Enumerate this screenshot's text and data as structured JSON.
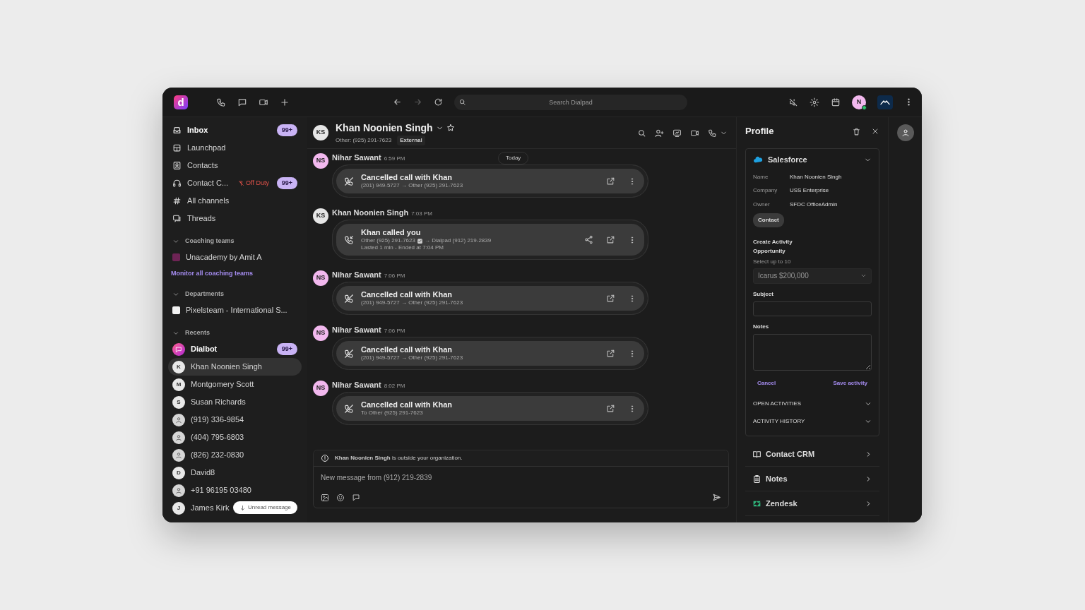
{
  "app_bar": {
    "logo": "d",
    "search_placeholder": "Search Dialpad",
    "user": {
      "initial": "N",
      "online": true
    }
  },
  "sidebar": {
    "nav": [
      {
        "label": "Inbox",
        "badge": "99+",
        "unread": true
      },
      {
        "label": "Launchpad",
        "unread": false
      },
      {
        "label": "Contacts",
        "unread": false
      },
      {
        "label": "Contact C...",
        "status": "Off Duty",
        "badge": "99+",
        "unread": false
      },
      {
        "label": "All channels",
        "unread": false
      },
      {
        "label": "Threads",
        "unread": false
      }
    ],
    "coaching_teams": {
      "title": "Coaching teams",
      "expanded": true,
      "items": [
        {
          "label": "Unacademy by Amit A",
          "color": "#6e2455"
        }
      ],
      "link": "Monitor all coaching teams"
    },
    "departments": {
      "title": "Departments",
      "expanded": true,
      "items": [
        {
          "label": "Pixelsteam - International S...",
          "color": "#f2f2f2"
        }
      ]
    },
    "recents": {
      "title": "Recents",
      "expanded": true,
      "items": [
        {
          "label": "Dialbot",
          "kind": "bot",
          "badge": "99+",
          "unread": true,
          "selected": false
        },
        {
          "label": "Khan Noonien Singh",
          "kind": "initial",
          "initial": "K",
          "unread": false,
          "selected": true
        },
        {
          "label": "Montgomery Scott",
          "kind": "initial",
          "initial": "M",
          "unread": false,
          "selected": false
        },
        {
          "label": "Susan Richards",
          "kind": "initial",
          "initial": "S",
          "unread": false,
          "selected": false
        },
        {
          "label": "(919) 336-9854",
          "kind": "person",
          "unread": false,
          "selected": false
        },
        {
          "label": "(404) 795-6803",
          "kind": "person",
          "unread": false,
          "selected": false
        },
        {
          "label": "(826) 232-0830",
          "kind": "person",
          "unread": false,
          "selected": false
        },
        {
          "label": "David8",
          "kind": "initial",
          "initial": "D",
          "unread": false,
          "selected": false
        },
        {
          "label": "+91 96195 03480",
          "kind": "person",
          "unread": false,
          "selected": false
        },
        {
          "label": "James Kirk",
          "kind": "initial",
          "initial": "J",
          "unread": false,
          "selected": false
        }
      ]
    },
    "unread_pill": "Unread message"
  },
  "conversation": {
    "avatar": "KS",
    "name": "Khan Noonien Singh",
    "starred": false,
    "phone": "Other: (925) 291-7623",
    "tag": "External",
    "date_divider": "Today",
    "messages": [
      {
        "avatar": "NS",
        "color": "#f2b8ee",
        "sender": "Nihar Sawant",
        "time": "6:59 PM",
        "call": {
          "kind": "cancelled",
          "title": "Cancelled call with Khan",
          "route": "(201) 949-5727 → Other (925) 291-7623",
          "share": false
        }
      },
      {
        "avatar": "KS",
        "color": "#e6e6e6",
        "sender": "Khan Noonien Singh",
        "time": "7:03 PM",
        "call": {
          "kind": "incoming",
          "title": "Khan called you",
          "route": "Other (925) 291-7623",
          "verified": true,
          "route_to": "→ Dialpad (912) 219-2839",
          "detail": "Lasted 1 min - Ended at 7:04 PM",
          "share": true
        }
      },
      {
        "avatar": "NS",
        "color": "#f2b8ee",
        "sender": "Nihar Sawant",
        "time": "7:06 PM",
        "call": {
          "kind": "cancelled",
          "title": "Cancelled call with Khan",
          "route": "(201) 949-5727 → Other (925) 291-7623",
          "share": false
        }
      },
      {
        "avatar": "NS",
        "color": "#f2b8ee",
        "sender": "Nihar Sawant",
        "time": "7:06 PM",
        "call": {
          "kind": "cancelled",
          "title": "Cancelled call with Khan",
          "route": "(201) 949-5727 → Other (925) 291-7623",
          "share": false
        }
      },
      {
        "avatar": "NS",
        "color": "#f2b8ee",
        "sender": "Nihar Sawant",
        "time": "8:02 PM",
        "call": {
          "kind": "cancelled",
          "title": "Cancelled call with Khan",
          "route": "To Other (925) 291-7623",
          "share": false
        }
      }
    ],
    "notice": "**Khan Noonien Singh** is outside your organization.",
    "composer": {
      "placeholder": "New message from (912) 219-2839"
    }
  },
  "profile": {
    "title": "Profile",
    "salesforce": {
      "title": "Salesforce",
      "expanded": true,
      "fields": [
        {
          "label": "Name",
          "value": "Khan Noonien Singh"
        },
        {
          "label": "Company",
          "value": "USS Enterprise"
        },
        {
          "label": "Owner",
          "value": "SFDC OfficeAdmin"
        }
      ],
      "tag": "Contact",
      "create_activity": {
        "title": "Create Activity",
        "subtitle": "Opportunity",
        "hint": "Select up to 10",
        "select_value": "Icarus $200,000",
        "subject_label": "Subject",
        "notes_label": "Notes",
        "cancel": "Cancel",
        "save": "Save activity"
      },
      "sections": [
        {
          "label": "OPEN ACTIVITIES",
          "expanded": false
        },
        {
          "label": "ACTIVITY HISTORY",
          "expanded": false
        }
      ]
    },
    "integrations": [
      {
        "label": "Contact CRM"
      },
      {
        "label": "Notes"
      },
      {
        "label": "Zendesk"
      }
    ]
  }
}
